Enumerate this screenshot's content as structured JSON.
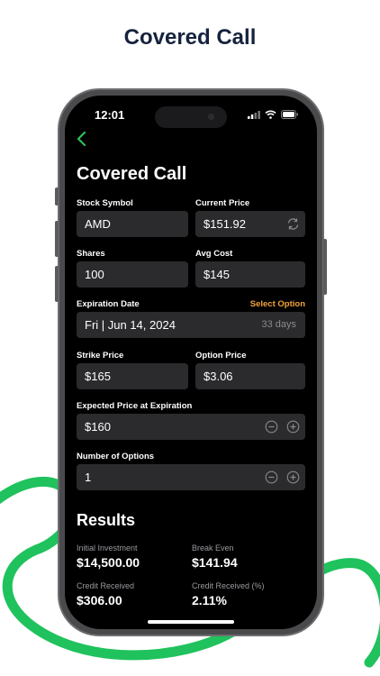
{
  "headline": "Covered Call",
  "status": {
    "time": "12:01"
  },
  "nav": {
    "back_icon": "chevron-left-icon",
    "accent": "#2fbd5c"
  },
  "title": "Covered Call",
  "form": {
    "stock_symbol": {
      "label": "Stock Symbol",
      "value": "AMD"
    },
    "current_price": {
      "label": "Current Price",
      "value": "$151.92"
    },
    "shares": {
      "label": "Shares",
      "value": "100"
    },
    "avg_cost": {
      "label": "Avg Cost",
      "value": "$145"
    },
    "expiration": {
      "label": "Expiration Date",
      "action": "Select Option",
      "value": "Fri | Jun 14, 2024",
      "days": "33 days"
    },
    "strike_price": {
      "label": "Strike Price",
      "value": "$165"
    },
    "option_price": {
      "label": "Option Price",
      "value": "$3.06"
    },
    "expected_price": {
      "label": "Expected Price at Expiration",
      "value": "$160"
    },
    "num_options": {
      "label": "Number of Options",
      "value": "1"
    }
  },
  "results": {
    "title": "Results",
    "initial_investment": {
      "label": "Initial Investment",
      "value": "$14,500.00"
    },
    "break_even": {
      "label": "Break Even",
      "value": "$141.94"
    },
    "credit_received": {
      "label": "Credit Received",
      "value": "$306.00"
    },
    "credit_received_pct": {
      "label": "Credit Received (%)",
      "value": "2.11%"
    }
  },
  "colors": {
    "accent_orange": "#f2a33a",
    "field_bg": "#2b2b2e",
    "brand_green": "#1fc25c",
    "headline": "#16233f"
  }
}
